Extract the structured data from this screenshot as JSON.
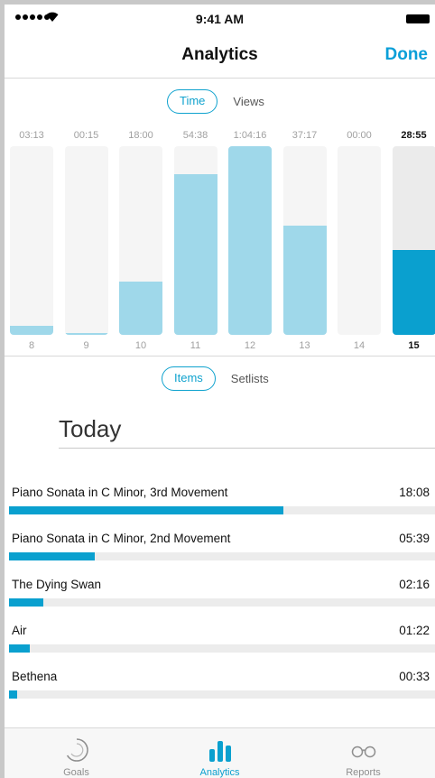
{
  "status_bar": {
    "time": "9:41 AM"
  },
  "nav": {
    "title": "Analytics",
    "done_label": "Done"
  },
  "chart_toggle": {
    "selected": "Time",
    "other": "Views"
  },
  "chart_data": {
    "type": "bar",
    "categories": [
      "8",
      "9",
      "10",
      "11",
      "12",
      "13",
      "14",
      "15"
    ],
    "value_labels": [
      "03:13",
      "00:15",
      "18:00",
      "54:38",
      "1:04:16",
      "37:17",
      "00:00",
      "28:55"
    ],
    "values_minutes": [
      3.22,
      0.25,
      18.0,
      54.63,
      64.27,
      37.28,
      0.0,
      28.92
    ],
    "ylim": [
      0,
      64.27
    ],
    "selected_category": "15",
    "colors": {
      "bar": "#9fd8ea",
      "selected_bar": "#0aa0cf",
      "track": "#f5f5f5"
    }
  },
  "list_toggle": {
    "selected": "Items",
    "other": "Setlists"
  },
  "section_title": "Today",
  "items": [
    {
      "title": "Piano Sonata in C Minor, 3rd Movement",
      "time": "18:08",
      "progress": 1.0
    },
    {
      "title": "Piano Sonata in C Minor, 2nd Movement",
      "time": "05:39",
      "progress": 0.311
    },
    {
      "title": "The Dying Swan",
      "time": "02:16",
      "progress": 0.125
    },
    {
      "title": "Air",
      "time": "01:22",
      "progress": 0.075
    },
    {
      "title": "Bethena",
      "time": "00:33",
      "progress": 0.03
    }
  ],
  "tabs": [
    {
      "label": "Goals",
      "icon": "goals-ring-icon"
    },
    {
      "label": "Analytics",
      "icon": "bar-chart-icon",
      "active": true
    },
    {
      "label": "Reports",
      "icon": "glasses-icon"
    }
  ],
  "accent_color": "#0aa0cf"
}
